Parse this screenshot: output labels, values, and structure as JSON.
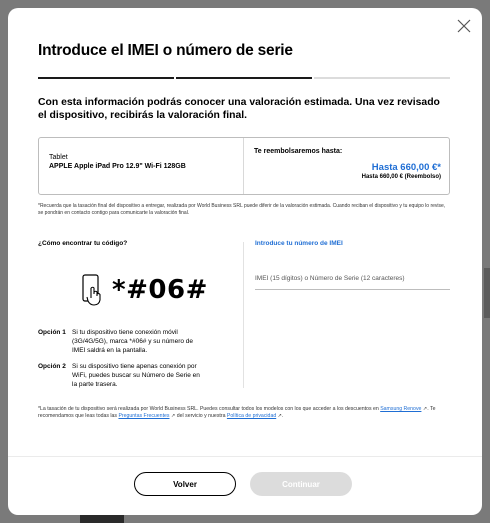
{
  "modal": {
    "title": "Introduce el IMEI o número de serie",
    "intro": "Con esta información podrás conocer una valoración estimada. Una vez revisado el dispositivo, recibirás la valoración final.",
    "progress": {
      "steps_total": 3,
      "steps_completed": 2
    }
  },
  "device": {
    "type": "Tablet",
    "model": "APPLE Apple iPad Pro 12.9\" Wi-Fi 128GB",
    "refund_label": "Te reembolsaremos hasta:",
    "refund_amount": "Hasta 660,00 €*",
    "refund_sub": "Hasta 660,00 € (Reembolso)"
  },
  "disclaimer": "*Recuerda que la tasación final del dispositivo a entregar, realizada por World Business SRL puede diferir de la valoración estimada. Cuando reciban el dispositivo y tu equipo lo revise, se pondrán en contacto contigo para comunicarte la valoración final.",
  "help": {
    "find_code": "¿Cómo encontrar tu código?",
    "code": "*#06#",
    "options": [
      {
        "label": "Opción 1",
        "text": "Si tu dispositivo tiene conexión móvil (3G/4G/5G), marca *#06# y su número de IMEI saldrá en la pantalla."
      },
      {
        "label": "Opción 2",
        "text": "Si su dispositivo tiene apenas conexión por WiFi, puedes buscar su Número de Serie en la parte trasera."
      }
    ]
  },
  "imei": {
    "label": "Introduce tu número de IMEI",
    "placeholder": "IMEI (15 dígitos) o Número de Serie (12 caracteres)"
  },
  "footnote": {
    "text1": "*La tasación de tu dispositivo será realizada por World Business SRL. Puedes consultar todos los modelos con los que acceder a los descuentos en ",
    "link1": "Samsung Renove",
    "text2": ". Te recomendamos que leas todas las ",
    "link2": "Preguntas Frecuentes",
    "text3": " del servicio y nuestra ",
    "link3": "Política de privacidad",
    "text4": "."
  },
  "buttons": {
    "back": "Volver",
    "continue": "Continuar"
  },
  "colors": {
    "accent": "#1f6ed4",
    "disabled": "#dcdcdc"
  }
}
